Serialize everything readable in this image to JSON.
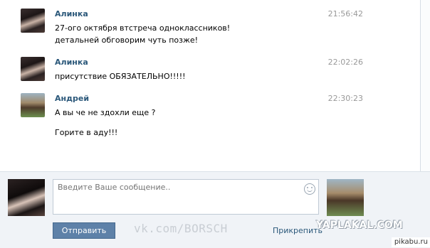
{
  "messages": [
    {
      "author": "Алинка",
      "time": "21:56:42",
      "lines": [
        "27-ого октября втстреча одноклассников!",
        "детальней обговорим чуть позже!"
      ]
    },
    {
      "author": "Алинка",
      "time": "22:02:26",
      "lines": [
        "присутствие ОБЯЗАТЕЛЬНО!!!!!"
      ]
    },
    {
      "author": "Андрей",
      "time": "22:30:23",
      "lines": [
        "А вы че не здохли еще ?",
        "Горите в аду!!!"
      ]
    }
  ],
  "composer": {
    "placeholder": "Введите Ваше сообщение..",
    "send_label": "Отправить",
    "attach_label": "Прикрепить"
  },
  "watermarks": {
    "vk": "vk.com/BORSCH",
    "yaplakal": "YAPLAKAL.COM",
    "pikabu": "pikabu.ru"
  },
  "colors": {
    "author": "#2b587a",
    "time": "#999999",
    "button": "#5e81a8",
    "composer_bg": "#f0f3f7"
  }
}
